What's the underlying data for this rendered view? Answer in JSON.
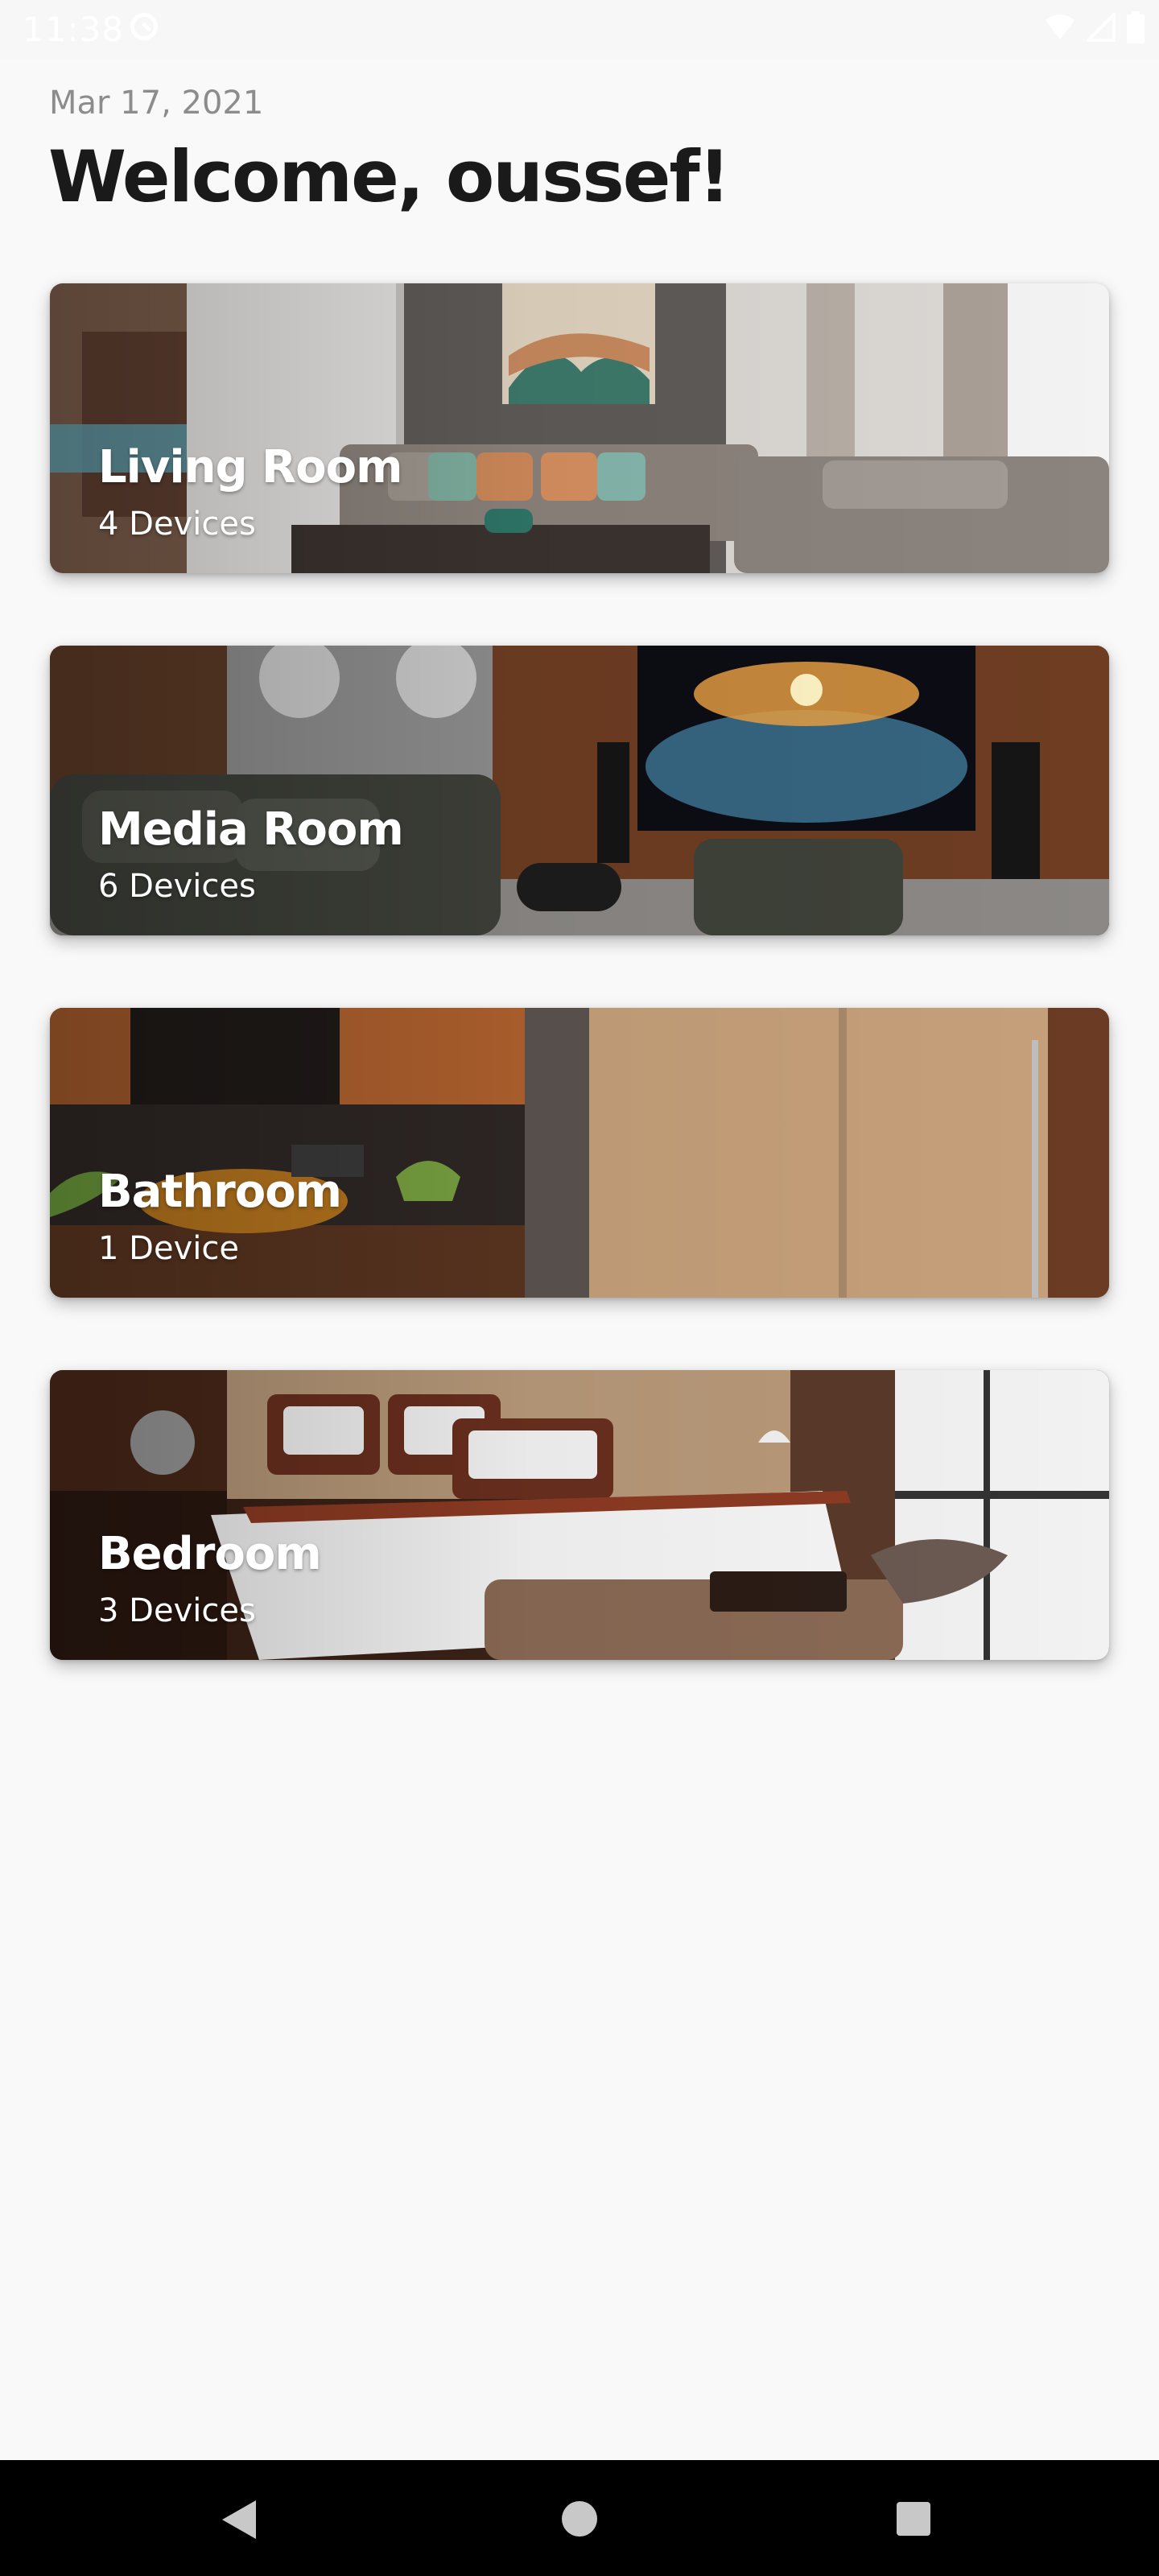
{
  "status_bar": {
    "time": "11:38",
    "icons": [
      "do-not-disturb-icon",
      "wifi-icon",
      "signal-icon",
      "battery-icon"
    ]
  },
  "header": {
    "date": "Mar 17, 2021",
    "welcome": "Welcome, oussef!"
  },
  "rooms": [
    {
      "name": "Living Room",
      "devices": "4 Devices"
    },
    {
      "name": "Media Room",
      "devices": "6 Devices"
    },
    {
      "name": "Bathroom",
      "devices": "1 Device"
    },
    {
      "name": "Bedroom",
      "devices": "3 Devices"
    }
  ],
  "nav_bar": {
    "icons": [
      "back-icon",
      "home-icon",
      "recents-icon"
    ]
  },
  "colors": {
    "background": "#f9f9f9",
    "title": "#1a1a1a",
    "date": "#8c8c8c",
    "card_text": "#ffffff",
    "nav_bar": "#000000"
  }
}
